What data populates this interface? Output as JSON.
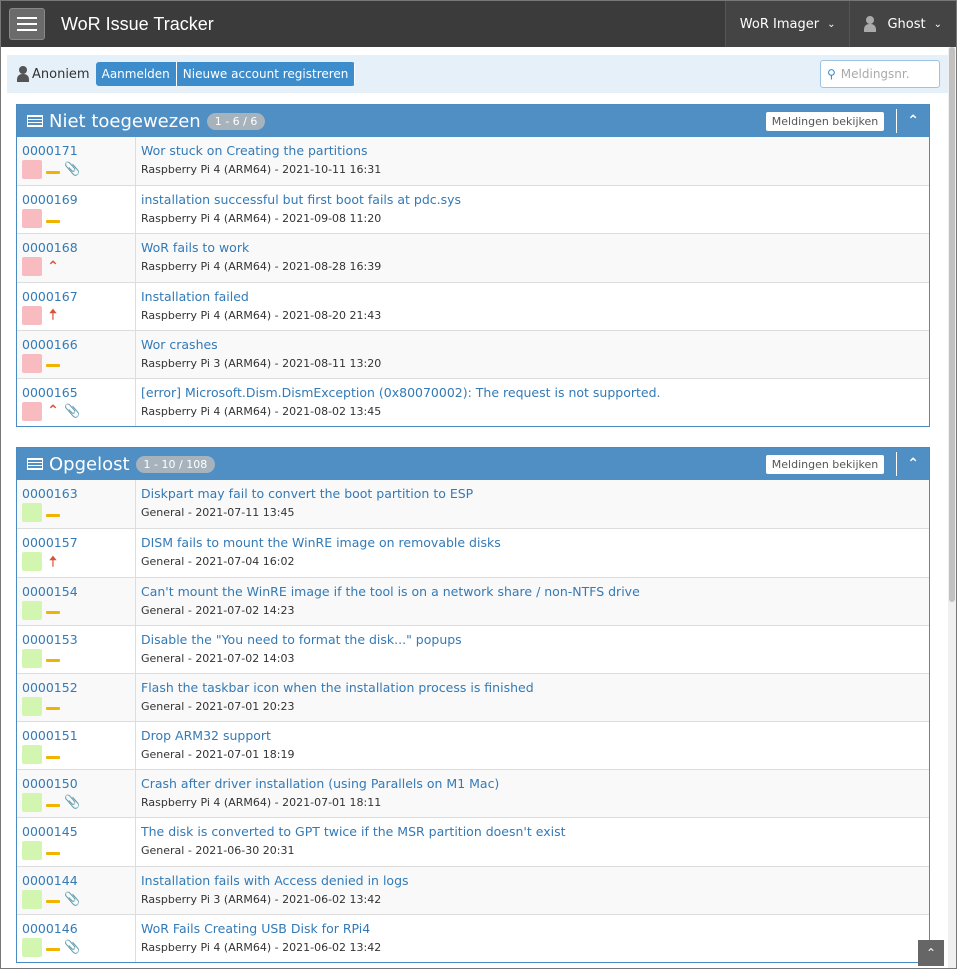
{
  "nav": {
    "title": "WoR Issue Tracker",
    "project": "WoR Imager",
    "user": "Ghost"
  },
  "crumb": {
    "user": "Anoniem",
    "login": "Aanmelden",
    "register": "Nieuwe account registreren",
    "search_placeholder": "Meldingsnr."
  },
  "colors": {
    "open": "#f8bcc0",
    "resolved": "#d2f5b0",
    "normal": "#f0b400",
    "high": "#d9533a"
  },
  "panels": [
    {
      "title": "Niet toegewezen",
      "badge": "1 - 6 / 6",
      "view": "Meldingen bekijken",
      "status": "open",
      "rows": [
        {
          "id": "0000171",
          "summary": "Wor stuck on Creating the partitions",
          "meta": "Raspberry Pi 4 (ARM64) - 2021-10-11 16:31",
          "priority": "normal",
          "attachment": true
        },
        {
          "id": "0000169",
          "summary": "installation successful but first boot fails at pdc.sys",
          "meta": "Raspberry Pi 4 (ARM64) - 2021-09-08 11:20",
          "priority": "normal",
          "attachment": false
        },
        {
          "id": "0000168",
          "summary": "WoR fails to work",
          "meta": "Raspberry Pi 4 (ARM64) - 2021-08-28 16:39",
          "priority": "high",
          "attachment": false
        },
        {
          "id": "0000167",
          "summary": "Installation failed",
          "meta": "Raspberry Pi 4 (ARM64) - 2021-08-20 21:43",
          "priority": "urgent",
          "attachment": false
        },
        {
          "id": "0000166",
          "summary": "Wor crashes",
          "meta": "Raspberry Pi 3 (ARM64) - 2021-08-11 13:20",
          "priority": "normal",
          "attachment": false
        },
        {
          "id": "0000165",
          "summary": "[error] Microsoft.Dism.DismException (0x80070002): The request is not supported.",
          "meta": "Raspberry Pi 4 (ARM64) - 2021-08-02 13:45",
          "priority": "high",
          "attachment": true
        }
      ]
    },
    {
      "title": "Opgelost",
      "badge": "1 - 10 / 108",
      "view": "Meldingen bekijken",
      "status": "resolved",
      "rows": [
        {
          "id": "0000163",
          "summary": "Diskpart may fail to convert the boot partition to ESP",
          "meta": "General - 2021-07-11 13:45",
          "priority": "normal",
          "attachment": false
        },
        {
          "id": "0000157",
          "summary": "DISM fails to mount the WinRE image on removable disks",
          "meta": "General - 2021-07-04 16:02",
          "priority": "urgent",
          "attachment": false
        },
        {
          "id": "0000154",
          "summary": "Can't mount the WinRE image if the tool is on a network share / non-NTFS drive",
          "meta": "General - 2021-07-02 14:23",
          "priority": "normal",
          "attachment": false
        },
        {
          "id": "0000153",
          "summary": "Disable the \"You need to format the disk...\" popups",
          "meta": "General - 2021-07-02 14:03",
          "priority": "normal",
          "attachment": false
        },
        {
          "id": "0000152",
          "summary": "Flash the taskbar icon when the installation process is finished",
          "meta": "General - 2021-07-01 20:23",
          "priority": "normal",
          "attachment": false
        },
        {
          "id": "0000151",
          "summary": "Drop ARM32 support",
          "meta": "General - 2021-07-01 18:19",
          "priority": "normal",
          "attachment": false
        },
        {
          "id": "0000150",
          "summary": "Crash after driver installation (using Parallels on M1 Mac)",
          "meta": "Raspberry Pi 4 (ARM64) - 2021-07-01 18:11",
          "priority": "normal",
          "attachment": true
        },
        {
          "id": "0000145",
          "summary": "The disk is converted to GPT twice if the MSR partition doesn't exist",
          "meta": "General - 2021-06-30 20:31",
          "priority": "normal",
          "attachment": false
        },
        {
          "id": "0000144",
          "summary": "Installation fails with Access denied in logs",
          "meta": "Raspberry Pi 3 (ARM64) - 2021-06-02 13:42",
          "priority": "normal",
          "attachment": true
        },
        {
          "id": "0000146",
          "summary": "WoR Fails Creating USB Disk for RPi4",
          "meta": "Raspberry Pi 4 (ARM64) - 2021-06-02 13:42",
          "priority": "normal",
          "attachment": true
        }
      ]
    }
  ]
}
